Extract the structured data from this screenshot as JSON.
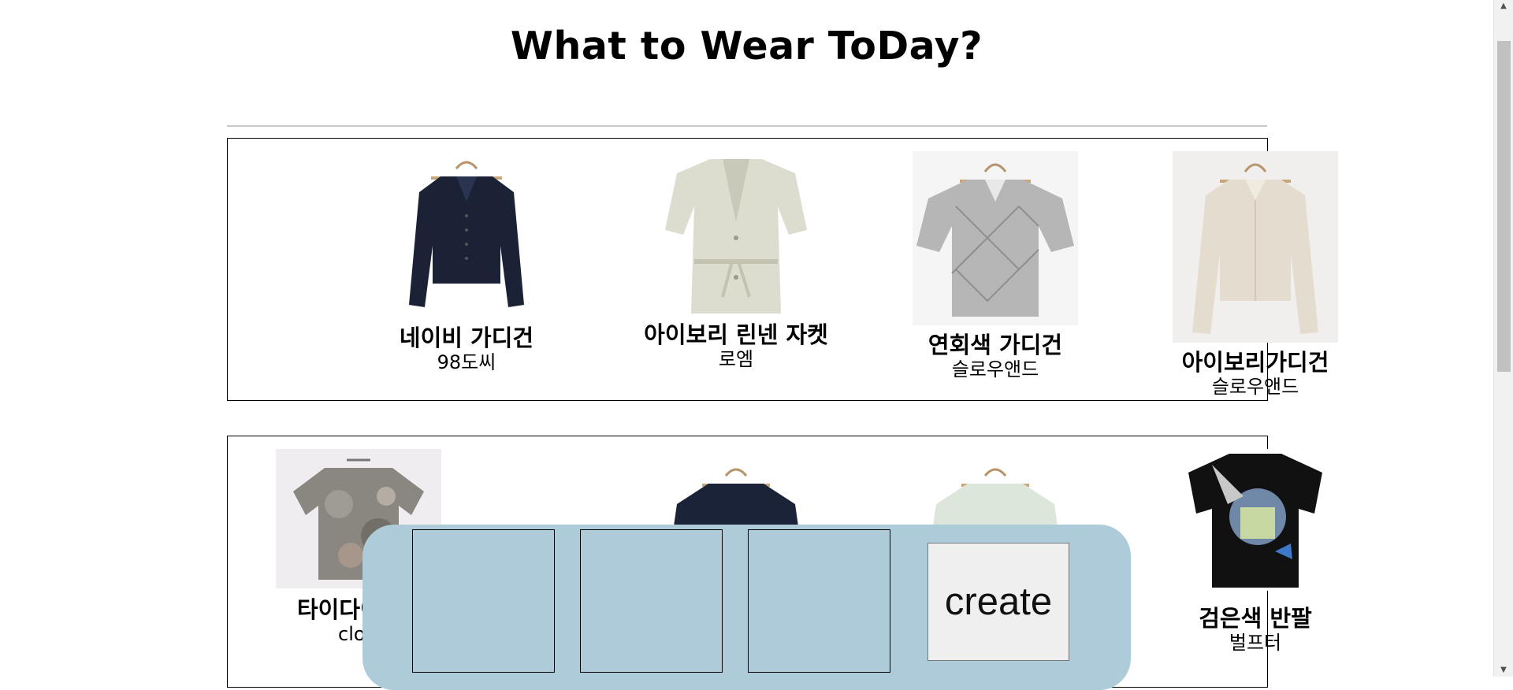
{
  "page": {
    "title": "What to Wear ToDay?"
  },
  "rows": [
    {
      "items": [
        {
          "name": "네이비 가디건",
          "brand": "98도씨",
          "icon": "navy-cardigan-image"
        },
        {
          "name": "아이보리 린넨 자켓",
          "brand": "로엠",
          "icon": "ivory-linen-jacket-image"
        },
        {
          "name": "연회색 가디건",
          "brand": "슬로우앤드",
          "icon": "light-gray-cardigan-image"
        },
        {
          "name": "아이보리가디건",
          "brand": "슬로우앤드",
          "icon": "ivory-cardigan-image"
        }
      ]
    },
    {
      "items": [
        {
          "name": "타이다이",
          "brand": "close",
          "icon": "tie-dye-top-image"
        },
        {
          "name": "",
          "brand": "",
          "icon": "navy-top-image"
        },
        {
          "name": "",
          "brand": "",
          "icon": "mint-top-image"
        },
        {
          "name": "검은색 반팔",
          "brand": "벌프터",
          "icon": "black-tshirt-image"
        }
      ]
    }
  ],
  "panel": {
    "create_label": "create",
    "color": "#aecbd9"
  }
}
